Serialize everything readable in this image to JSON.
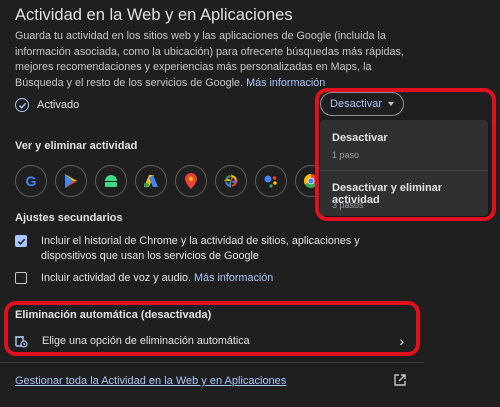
{
  "title": "Actividad en la Web y en Aplicaciones",
  "description": "Guarda tu actividad en los sitios web y las aplicaciones de Google (incluida la información asociada, como la ubicación) para ofrecerte búsquedas más rápidas, mejores recomendaciones y experiencias más personalizadas en Maps, la Búsqueda y el resto de los servicios de Google.",
  "more_info": "Más información",
  "status_label": "Activado",
  "dropdown_label": "Desactivar",
  "menu": {
    "item1_label": "Desactivar",
    "item1_sub": "1 paso",
    "item2_label": "Desactivar y eliminar actividad",
    "item2_sub": "3 pasos"
  },
  "view_delete_heading": "Ver y eliminar actividad",
  "app_icons": [
    "google-icon",
    "play-store-icon",
    "android-icon",
    "google-ads-icon",
    "maps-icon",
    "google-photos-icon",
    "assistant-icon",
    "chrome-icon"
  ],
  "secondary_heading": "Ajustes secundarios",
  "secondary": {
    "chrome_history": "Incluir el historial de Chrome y la actividad de sitios, aplicaciones y dispositivos que usan los servicios de Google",
    "voice_audio": "Incluir actividad de voz y audio.",
    "voice_more_info": "Más información"
  },
  "auto_delete_title": "Eliminación automática (desactivada)",
  "auto_delete_option": "Elige una opción de eliminación automática",
  "manage_all": "Gestionar toda la Actividad en la Web y en Aplicaciones",
  "colors": {
    "accent": "#a8c7fa",
    "highlight": "#e0101e",
    "background": "#1f1f1f"
  }
}
